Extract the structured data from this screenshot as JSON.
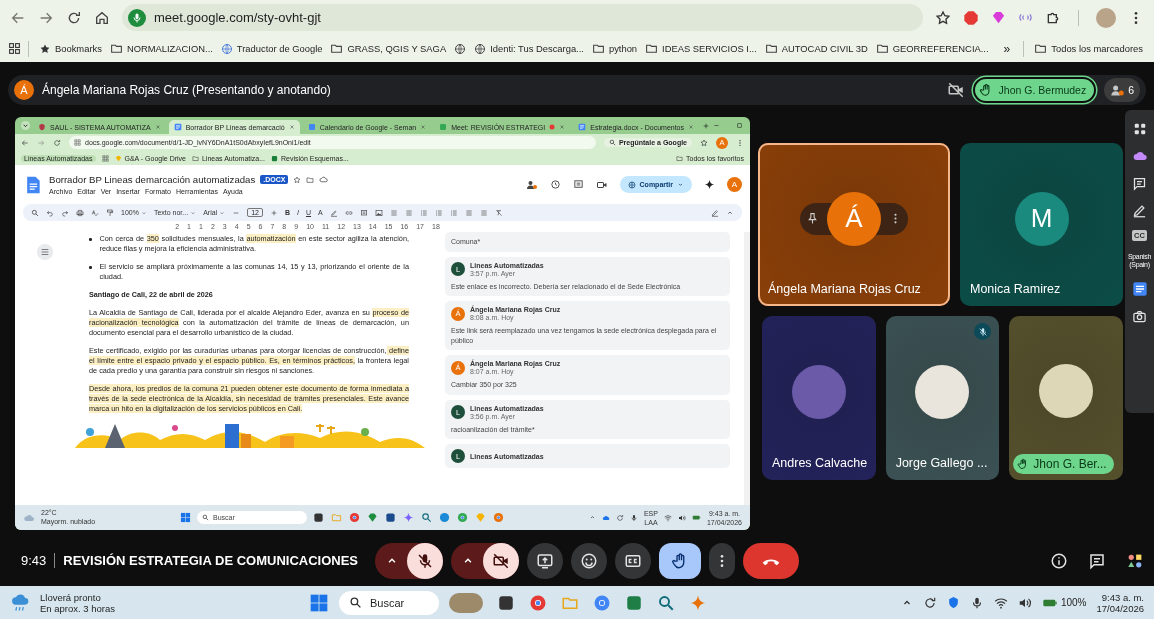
{
  "browser": {
    "url": "meet.google.com/sty-ovht-gjt",
    "bookmarks": [
      {
        "kind": "star",
        "label": "Bookmarks"
      },
      {
        "kind": "folder",
        "label": "NORMALIZACION..."
      },
      {
        "kind": "site",
        "label": "Traductor de Google"
      },
      {
        "kind": "folder",
        "label": "GRASS, QGIS Y SAGA"
      },
      {
        "kind": "site"
      },
      {
        "kind": "site",
        "label": "Identi: Tus Descarga..."
      },
      {
        "kind": "folder",
        "label": "python"
      },
      {
        "kind": "folder",
        "label": "IDEAS SERVICIOS I..."
      },
      {
        "kind": "folder",
        "label": "AUTOCAD CIVIL 3D"
      },
      {
        "kind": "folder",
        "label": "GEORREFERENCIA..."
      }
    ],
    "overflow": "»",
    "all_bookmarks": "Todos los marcadores"
  },
  "meet": {
    "presenter": {
      "initial": "Á",
      "label": "Ángela Mariana Rojas Cruz (Presentando y anotando)"
    },
    "raised_hand": "Jhon G. Bermudez",
    "participant_count": "6",
    "shared_screen": {
      "tabs": [
        {
          "label": "SAUL - SISTEMA AUTOMATIZA",
          "selected": false
        },
        {
          "label": "Borrador BP Lineas demarcació",
          "selected": true
        },
        {
          "label": "Calendario de Google - Seman",
          "selected": false
        },
        {
          "label": "Meet: REVISIÓN ESTRATEGI",
          "selected": false
        },
        {
          "label": "Estrategia.docx - Documentos",
          "selected": false
        }
      ],
      "url": "docs.google.com/document/d/1-JD_lvNY6DnA1tS0dAbxyIefL9nOni1/edit",
      "ask_google": "Pregúntale a Google",
      "profile_initial": "A",
      "bookmarks": [
        "Lineas Automatizadas",
        "G&A - Google Drive",
        "Lineas Automatiza...",
        "Revisión Esquemas..."
      ],
      "all_bookmarks": "Todos los favoritos",
      "doc": {
        "title": "Borrador BP Lineas demarcación automatizadas",
        "badge": ".DOCX",
        "menus": [
          "Archivo",
          "Editar",
          "Ver",
          "Insertar",
          "Formato",
          "Herramientas",
          "Ayuda"
        ],
        "share": "Compartir",
        "avatar": "A",
        "zoom": "100%",
        "style": "Texto nor...",
        "font": "Arial",
        "size": "12",
        "format": [
          "B",
          "I",
          "U",
          "A"
        ],
        "ruler": [
          "2",
          "1",
          "1",
          "2",
          "3",
          "4",
          "5",
          "6",
          "7",
          "8",
          "9",
          "10",
          "11",
          "12",
          "13",
          "14",
          "15",
          "16",
          "17",
          "18"
        ],
        "blocks": [
          {
            "kind": "bullet",
            "segments": [
              {
                "text": "Con cerca de ",
                "highlighted": false
              },
              {
                "text": "350",
                "highlighted": true
              },
              {
                "text": " solicitudes mensuales, la ",
                "highlighted": false
              },
              {
                "text": "automatización",
                "highlighted": true
              },
              {
                "text": " en este sector agiliza la atención, reduce filas y mejora la eficiencia administrativa.",
                "highlighted": false
              }
            ]
          },
          {
            "kind": "bullet",
            "segments": [
              {
                "text": "El servicio se ampliará próximamente a las comunas 14, 15 y 13, priorizando el oriente de la ciudad.",
                "highlighted": false
              }
            ]
          },
          {
            "kind": "heading",
            "segments": [
              {
                "text": "Santiago de Cali, 22 de abril de 2026",
                "highlighted": false
              }
            ]
          },
          {
            "kind": "paragraph",
            "segments": [
              {
                "text": "La Alcaldía de Santiago de Cali, liderada por el alcalde Alejandro Eder, avanza en su ",
                "highlighted": false
              },
              {
                "text": "proceso de racionalización tecnológica",
                "highlighted": true
              },
              {
                "text": " con la automatización del trámite de líneas de demarcación, un documento esencial para el desarrollo urbanístico de la ciudad.",
                "highlighted": false
              }
            ]
          },
          {
            "kind": "paragraph",
            "segments": [
              {
                "text": "Este certificado, exigido por las curadurías urbanas para otorgar licencias de construcción,",
                "highlighted": false
              },
              {
                "text": " define el límite entre el espacio privado y el espacio público. Es, en términos prácticos,",
                "highlighted": true
              },
              {
                "text": " la frontera legal de cada predio y una garantía para construir sin riesgos ni sanciones.",
                "highlighted": false
              }
            ]
          },
          {
            "kind": "paragraph",
            "segments": [
              {
                "text": "Desde ahora, los predios de la comuna 21 pueden obtener este documento de forma inmediata a través de la sede electrónica de la Alcaldía, sin necesidad de trámites presenciales. Este avance marca un hito en la digitalización de los servicios públicos en Cali.",
                "highlighted": true
              }
            ]
          }
        ],
        "comments": [
          {
            "text": "Comuna*"
          },
          {
            "author": "Lineas Automatizadas",
            "initial": "L",
            "color": "#1d4f3b",
            "time": "3:57 p.m. Ayer",
            "text": "Este enlace es incorrecto. Debería ser relacionado el de Sede Electrónica"
          },
          {
            "author": "Ángela Mariana Rojas Cruz",
            "initial": "Á",
            "color": "#e8710a",
            "time": "8:08 a.m. Hoy",
            "text": "Este link será reemplazado una vez tengamos la sede electrónica desplegada para el público"
          },
          {
            "author": "Ángela Mariana Rojas Cruz",
            "initial": "Á",
            "color": "#e8710a",
            "time": "8:07 a.m. Hoy",
            "text": "Cambiar 350 por 325"
          },
          {
            "author": "Lineas Automatizadas",
            "initial": "L",
            "color": "#1d4f3b",
            "time": "3:56 p.m. Ayer",
            "text": "racioanlización del trámite*"
          },
          {
            "author": "Lineas Automatizadas",
            "initial": "L",
            "color": "#1d4f3b"
          }
        ]
      },
      "taskbar": {
        "temperature": "22°C",
        "weather": "Mayorm. nublado",
        "search": "Buscar",
        "language": "ESP",
        "layout": "LAA",
        "time": "9:43 a. m.",
        "date": "17/04/2026"
      }
    },
    "tiles": [
      {
        "name": "Ángela Mariana Rojas Cruz",
        "kind": "initial",
        "initial": "Á",
        "color": "#8a3f08",
        "speaking": true,
        "muted": false,
        "hand_raised": false
      },
      {
        "name": "Monica Ramirez",
        "kind": "initial",
        "initial": "M",
        "color": "#0c4d47",
        "speaking": false,
        "muted": false,
        "hand_raised": false
      },
      {
        "name": "Andres Calvache",
        "kind": "photo",
        "color": "#23225a",
        "speaking": false,
        "muted": false,
        "hand_raised": false
      },
      {
        "name": "Jorge Gallego ...",
        "kind": "photo",
        "color": "#3b5153",
        "speaking": false,
        "muted": true,
        "hand_raised": false
      },
      {
        "name": "Jhon G. Ber...",
        "kind": "photo",
        "color": "#55502c",
        "speaking": false,
        "muted": false,
        "hand_raised": true
      }
    ],
    "side_panel": {
      "captions": "CC",
      "language": "Spanish (Spain)"
    },
    "meeting_time": "9:43",
    "meeting_title": "REVISIÓN ESTRATEGIA DE COMUNICACIONES",
    "controls": [
      {
        "kind": "mic",
        "on": false
      },
      {
        "kind": "camera",
        "on": false
      },
      {
        "kind": "present",
        "on": false
      },
      {
        "kind": "emoji",
        "on": false
      },
      {
        "kind": "captions",
        "on": false
      },
      {
        "kind": "hand",
        "on": true
      },
      {
        "kind": "more",
        "on": false
      },
      {
        "kind": "leave",
        "on": false
      }
    ]
  },
  "taskbar": {
    "weather": "Lloverá pronto",
    "forecast": "En aprox. 3 horas",
    "search": "Buscar",
    "battery": "100%",
    "time": "9:43 a. m.",
    "date": "17/04/2026"
  }
}
